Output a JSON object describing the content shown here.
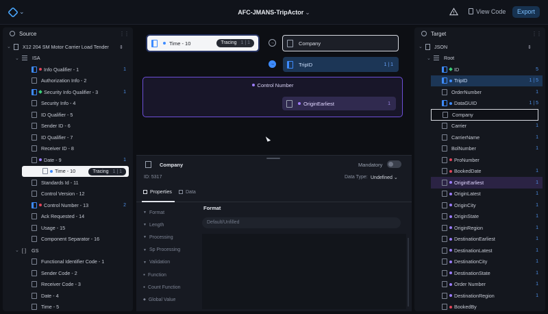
{
  "header": {
    "title": "AFC-JMANS-TripActor",
    "view_code": "View Code",
    "export": "Export"
  },
  "source": {
    "title": "Source",
    "root_label": "X12 204 SM Motor Carrier Load Tender",
    "isa_label": "ISA",
    "gs_label": "GS",
    "gs_brackets": "[ ]",
    "items": [
      {
        "label": "Info Qualifier - 1",
        "badge": "1"
      },
      {
        "label": "Authorization Info - 2",
        "badge": ""
      },
      {
        "label": "Security Info Qualifier - 3",
        "badge": "1"
      },
      {
        "label": "Security Info - 4",
        "badge": ""
      },
      {
        "label": "ID Qualifier - 5",
        "badge": ""
      },
      {
        "label": "Sender ID - 6",
        "badge": ""
      },
      {
        "label": "ID Qualifier - 7",
        "badge": ""
      },
      {
        "label": "Receiver ID - 8",
        "badge": ""
      },
      {
        "label": "Date - 9",
        "badge": "1"
      },
      {
        "label": "Time - 10",
        "badge": ""
      },
      {
        "label": "Standards Id - 11",
        "badge": ""
      },
      {
        "label": "Control Version - 12",
        "badge": ""
      },
      {
        "label": "Control Number - 13",
        "badge": "2"
      },
      {
        "label": "Ack Requested - 14",
        "badge": ""
      },
      {
        "label": "Usage - 15",
        "badge": ""
      },
      {
        "label": "Component Separator - 16",
        "badge": ""
      }
    ],
    "gs_items": [
      {
        "label": "Functional Identifier Code - 1"
      },
      {
        "label": "Sender Code - 2"
      },
      {
        "label": "Receiver Code - 3"
      },
      {
        "label": "Date - 4"
      },
      {
        "label": "Time - 5"
      }
    ],
    "tracing": "Tracing",
    "tracing_count": "1 | 1"
  },
  "canvas": {
    "time_node": "Time - 10",
    "time_tracing": "Tracing",
    "time_count": "1 | 1",
    "company_node": "Company",
    "tripid_node": "TripID",
    "tripid_count": "1 | 1",
    "group_label": "Control Number",
    "origin_node": "OriginEarliest",
    "origin_count": "1"
  },
  "props": {
    "title": "Company",
    "mandatory": "Mandatory",
    "id": "ID: 5317",
    "datatype_label": "Data Type:",
    "datatype_value": "Undefined",
    "tab_properties": "Properties",
    "tab_data": "Data",
    "list": [
      "Format",
      "Length",
      "Processing",
      "Sp Processing",
      "Validation",
      "Function",
      "Count Function",
      "Global Value"
    ],
    "format_title": "Format",
    "format_placeholder": "Default/Unfilled"
  },
  "target": {
    "title": "Target",
    "json_label": "JSON",
    "root_label": "Root",
    "items": [
      {
        "label": "ID",
        "badge": "5"
      },
      {
        "label": "TripID",
        "badge": "1 | 5"
      },
      {
        "label": "OrderNumber",
        "badge": "1"
      },
      {
        "label": "DataGUID",
        "badge": "1 | 5"
      },
      {
        "label": "Company",
        "badge": ""
      },
      {
        "label": "Carrier",
        "badge": "1"
      },
      {
        "label": "CarrierName",
        "badge": "1"
      },
      {
        "label": "BolNumber",
        "badge": "1"
      },
      {
        "label": "ProNumber",
        "badge": ""
      },
      {
        "label": "BookedDate",
        "badge": "1"
      },
      {
        "label": "OriginEarliest",
        "badge": "1"
      },
      {
        "label": "OriginLatest",
        "badge": "1"
      },
      {
        "label": "OriginCity",
        "badge": "1"
      },
      {
        "label": "OriginState",
        "badge": "1"
      },
      {
        "label": "OriginRegion",
        "badge": "1"
      },
      {
        "label": "DestinationEarliest",
        "badge": "1"
      },
      {
        "label": "DestinationLatest",
        "badge": "1"
      },
      {
        "label": "DestinationCity",
        "badge": "1"
      },
      {
        "label": "DestinationState",
        "badge": "1"
      },
      {
        "label": "Order Number",
        "badge": "1"
      },
      {
        "label": "DestinationRegion",
        "badge": "1"
      },
      {
        "label": "BookedBy",
        "badge": ""
      }
    ]
  },
  "colors": {
    "accent": "#3d8bff",
    "purple": "#6d4fd8",
    "required": "#e0445a",
    "green": "#3ccf7a"
  }
}
